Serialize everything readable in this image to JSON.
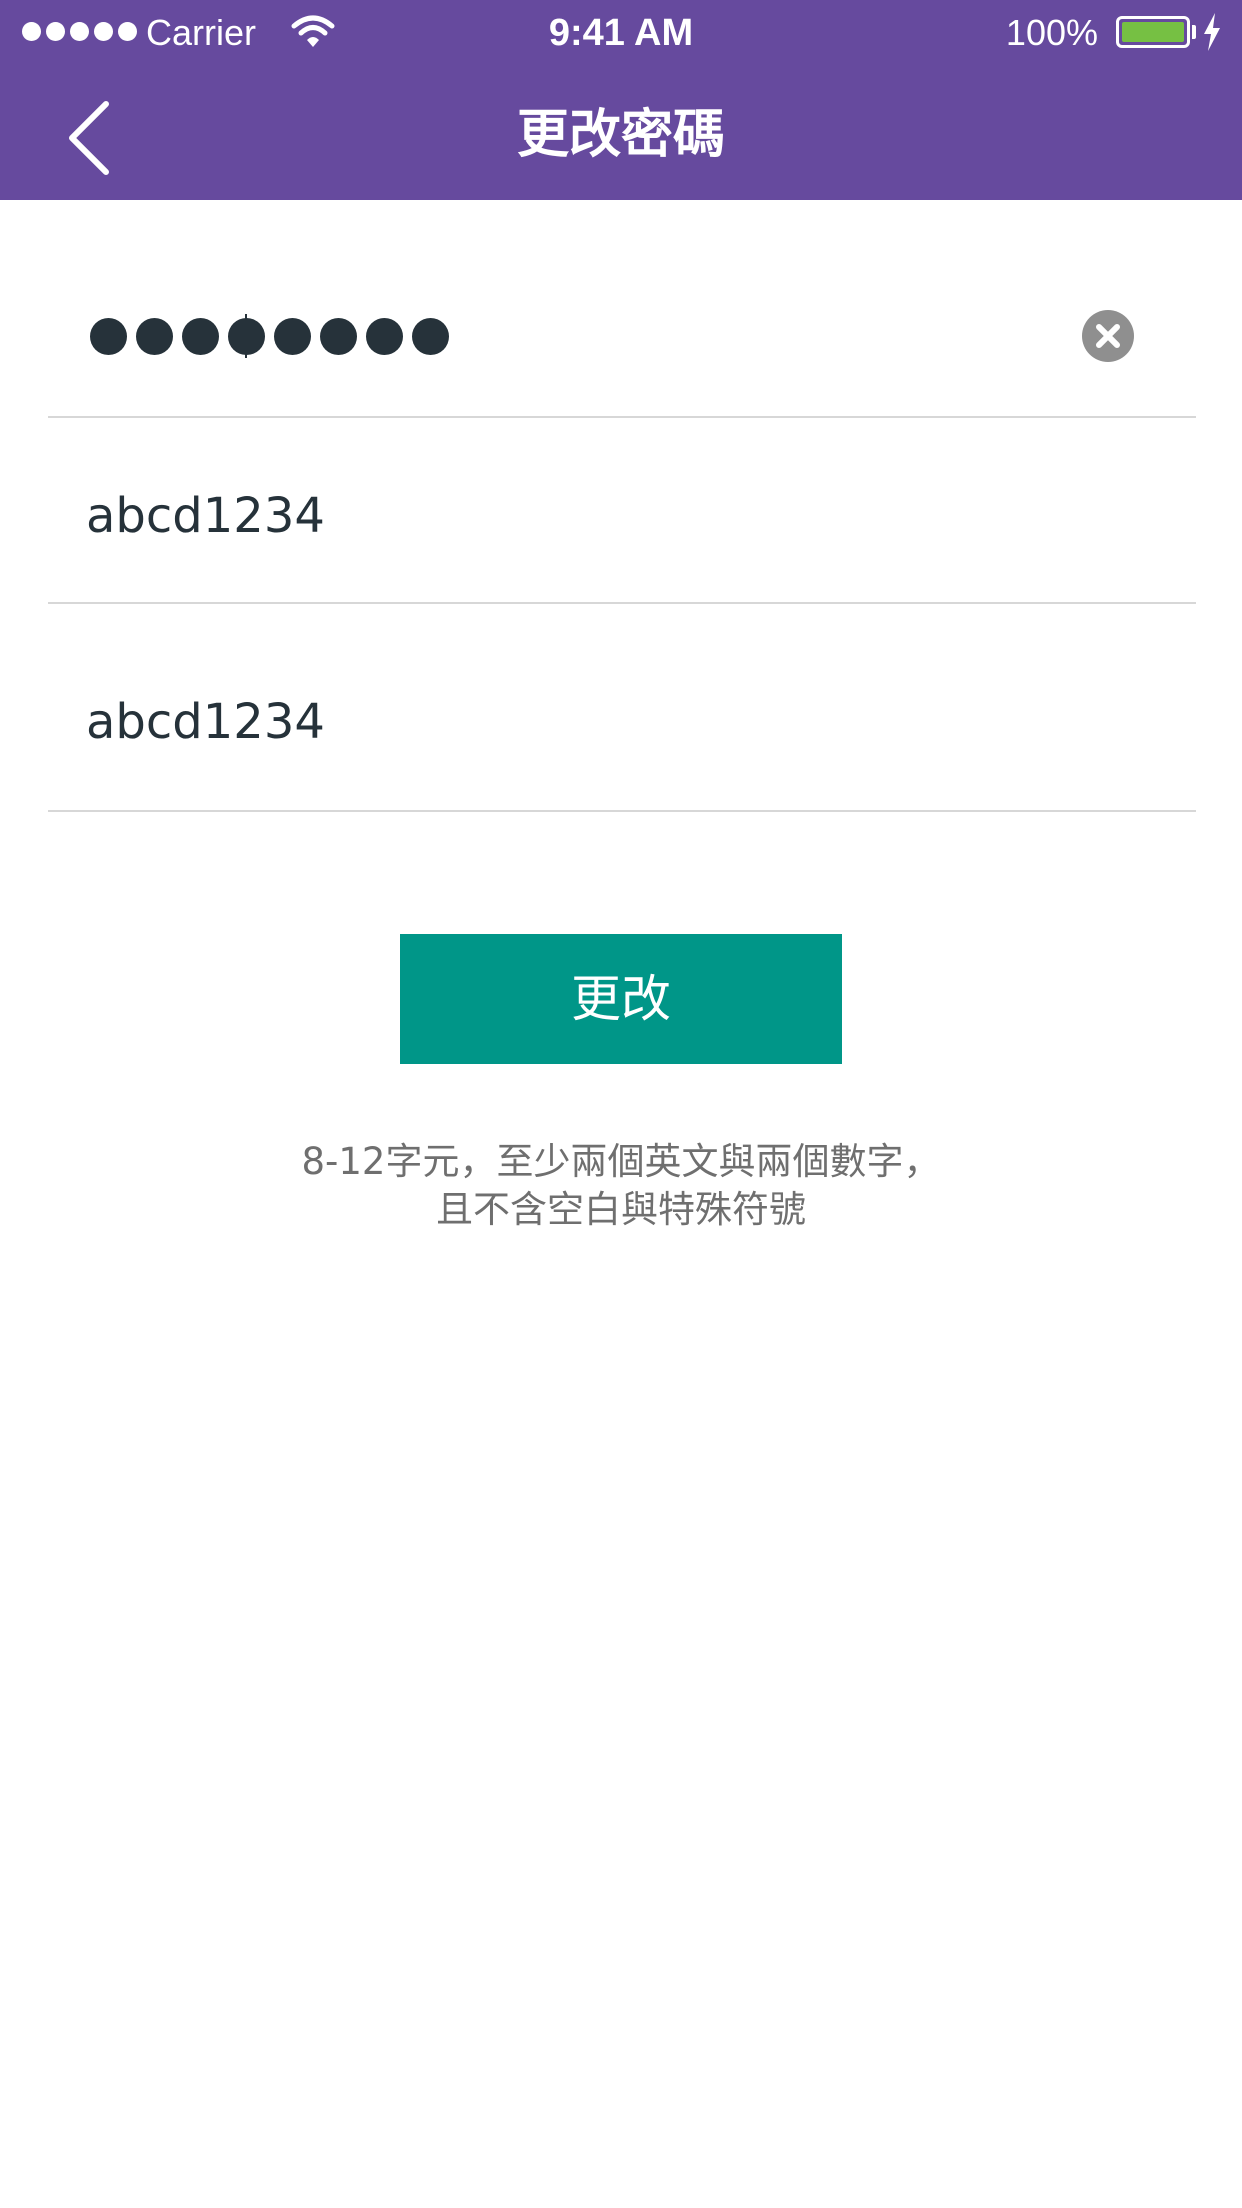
{
  "status_bar": {
    "carrier": "Carrier",
    "time": "9:41 AM",
    "battery": "100%",
    "icons": [
      "signal-dots-icon",
      "wifi-icon",
      "battery-icon",
      "charging-bolt-icon"
    ]
  },
  "nav": {
    "title": "更改密碼",
    "back_icon": "chevron-left-icon"
  },
  "form": {
    "current_password": {
      "masked_length": 8,
      "clear_icon": "clear-circle-icon"
    },
    "new_password": {
      "value": "abcd1234"
    },
    "confirm_password": {
      "value": "abcd1234"
    }
  },
  "submit": {
    "label": "更改"
  },
  "hint": {
    "line1": "8-12字元，至少兩個英文與兩個數字，",
    "line2": "且不含空白與特殊符號"
  },
  "colors": {
    "header": "#664a9e",
    "button": "#009688",
    "battery_fill": "#76c043",
    "text": "#26323a",
    "hint_text": "#6f6f6f",
    "divider": "#d7d7d7"
  }
}
